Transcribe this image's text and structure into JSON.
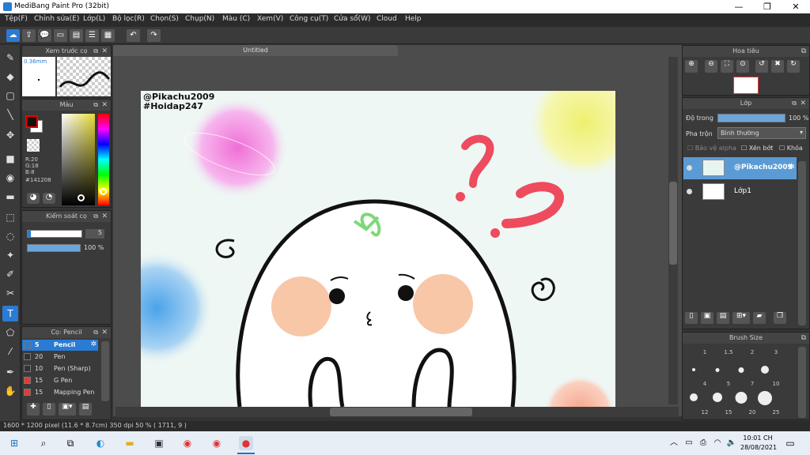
{
  "window": {
    "title": "MediBang Paint Pro (32bit)",
    "minimize": "—",
    "maximize": "❐",
    "close": "✕"
  },
  "menu": [
    "Tệp(F)",
    "Chỉnh sửa(E)",
    "Lớp(L)",
    "Bộ lọc(R)",
    "Chọn(S)",
    "Chụp(N)",
    "Màu (C)",
    "Xem(V)",
    "Công cụ(T)",
    "Cửa sổ(W)",
    "Cloud",
    "Help"
  ],
  "document": {
    "tab_title": "Untitled"
  },
  "brush_preview": {
    "title": "Xem trước cọ",
    "size": "0.36mm"
  },
  "color_panel": {
    "title": "Màu",
    "r": "R:20",
    "g": "G:18",
    "b": "B:8",
    "hex": "#141208",
    "current_color": "#141208"
  },
  "brush_control": {
    "title": "Kiểm soát cọ",
    "size_value": "5",
    "opacity_value": "100 %"
  },
  "brush_list": {
    "title": "Cọ: Pencil",
    "items": [
      {
        "size": "5",
        "name": "Pencil",
        "color": "#2a7bd4"
      },
      {
        "size": "20",
        "name": "Pen",
        "color": "#333333"
      },
      {
        "size": "10",
        "name": "Pen (Sharp)",
        "color": "#333333"
      },
      {
        "size": "15",
        "name": "G Pen",
        "color": "#e53935"
      },
      {
        "size": "15",
        "name": "Mapping Pen",
        "color": "#e53935"
      }
    ]
  },
  "artwork": {
    "watermark_line1": "@Pikachu2009",
    "watermark_line2": "#Hoidap247"
  },
  "navigator": {
    "title": "Hoa tiêu"
  },
  "layer_panel": {
    "title": "Lớp",
    "opacity_label": "Độ trong",
    "opacity_value": "100 %",
    "blend_label": "Pha trộn",
    "blend_value": "Bình thường",
    "protect_alpha": "Bảo vệ alpha",
    "clipping": "Xén bớt",
    "lock": "Khóa",
    "layers": [
      {
        "name": "@Pikachu2009",
        "selected": true
      },
      {
        "name": "Lớp1",
        "selected": false
      }
    ]
  },
  "brush_size": {
    "title": "Brush Size",
    "sizes": [
      "1",
      "1.5",
      "2",
      "3",
      "4",
      "5",
      "7",
      "10",
      "12",
      "15",
      "20",
      "25"
    ]
  },
  "status": {
    "dimensions": "1600 * 1200 pixel   (11.6 * 8.7cm)   350 dpi   50 %   ( 1711, 9 )"
  },
  "taskbar": {
    "time": "10:01 CH",
    "date": "28/08/2021"
  },
  "colors": {
    "accent": "#2a7bd4",
    "panel": "#3a3a3a",
    "layer_selected": "#5b9bd5",
    "canvas_bg": "#eef7f4"
  }
}
